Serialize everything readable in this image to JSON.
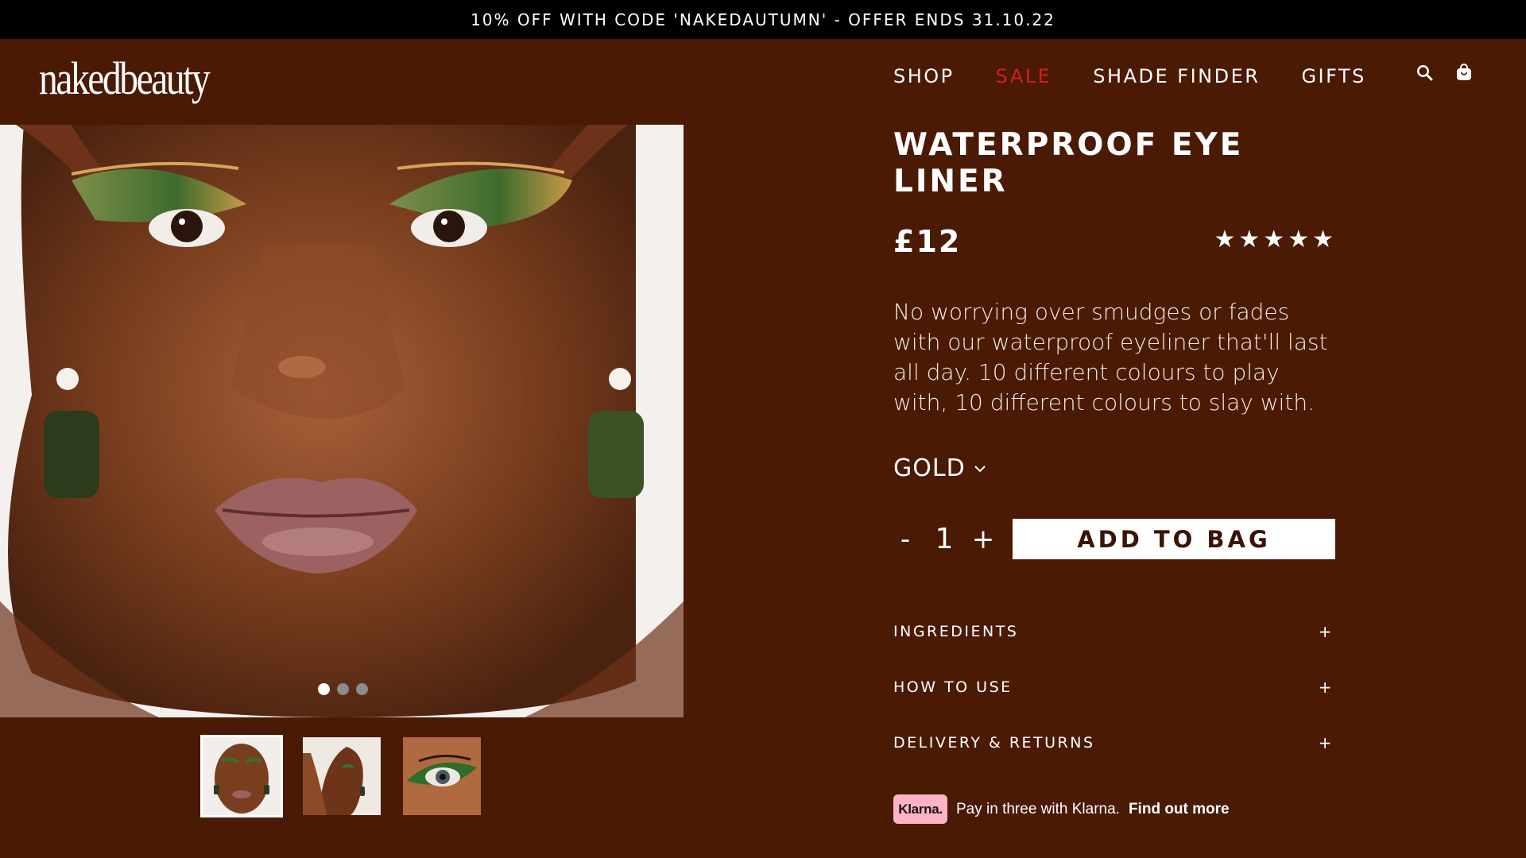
{
  "promo": {
    "text": "10% OFF WITH CODE 'NAKEDAUTUMN' - OFFER ENDS 31.10.22"
  },
  "brand": {
    "logo_text": "nakedbeauty"
  },
  "nav": {
    "items": [
      {
        "label": "SHOP"
      },
      {
        "label": "SALE"
      },
      {
        "label": "SHADE FINDER"
      },
      {
        "label": "GIFTS"
      }
    ],
    "sale_color": "#d21e1e"
  },
  "header_icons": [
    "search-icon",
    "bag-icon"
  ],
  "product": {
    "title": "WATERPROOF EYE LINER",
    "price": "£12",
    "rating_stars": "★★★★★",
    "rating": 5,
    "description": "No worrying over smudges or fades with our waterproof eyeliner that'll last all day. 10 different colours to play with, 10 different colours to slay with.",
    "shade": "GOLD",
    "quantity": "1",
    "minus": "-",
    "plus": "+",
    "add_to_bag": "ADD TO BAG"
  },
  "gallery": {
    "slide_count": 3,
    "active_slide": 1,
    "thumbnails": 3
  },
  "accordion": [
    {
      "label": "INGREDIENTS",
      "icon": "+"
    },
    {
      "label": "HOW TO USE",
      "icon": "+"
    },
    {
      "label": "DELIVERY & RETURNS",
      "icon": "+"
    }
  ],
  "klarna": {
    "badge": "Klarna.",
    "text": "Pay in three with Klarna.",
    "link": "Find out more"
  },
  "colors": {
    "background": "#4a1a05",
    "promo_bar": "#000000",
    "klarna_pink": "#ffb3c7"
  }
}
